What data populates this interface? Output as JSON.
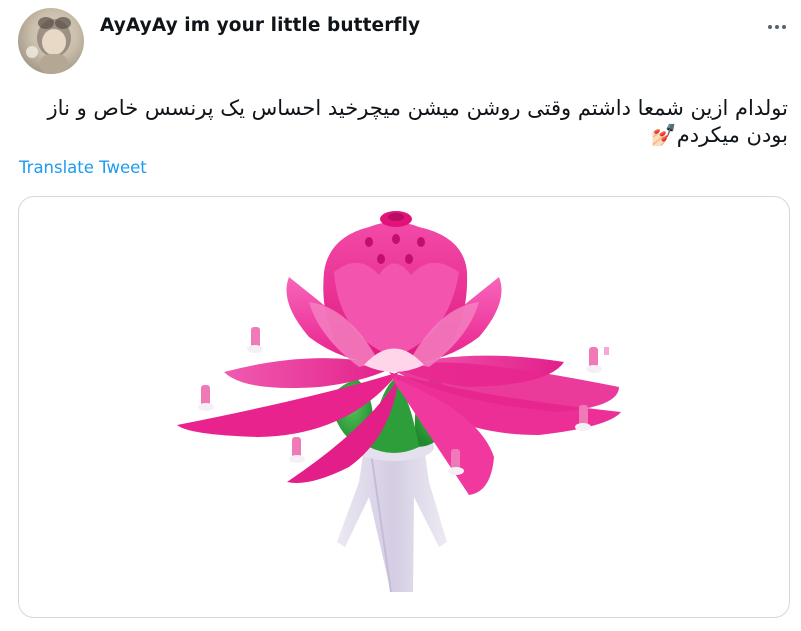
{
  "tweet": {
    "display_name": "AyAyAy im your little butterfly",
    "text_line_1": "تولدام ازین شمعا داشتم وقتی روشن میشن میچرخید احساس یک پرنسس خاص و ناز",
    "text_line_2": "بودن میکردم💅🏻",
    "translate_label": "Translate Tweet",
    "more_icon": "more-horizontal-icon"
  },
  "media": {
    "subject": "pink lotus flower birthday candle",
    "colors": {
      "petal": "#f0319a",
      "petal_light": "#f87fc1",
      "leaf": "#2e9e3a",
      "stand": "#d9d4e6"
    }
  },
  "colors": {
    "link": "#1d9bf0",
    "text": "#0f1419",
    "border": "#cfd9de"
  }
}
